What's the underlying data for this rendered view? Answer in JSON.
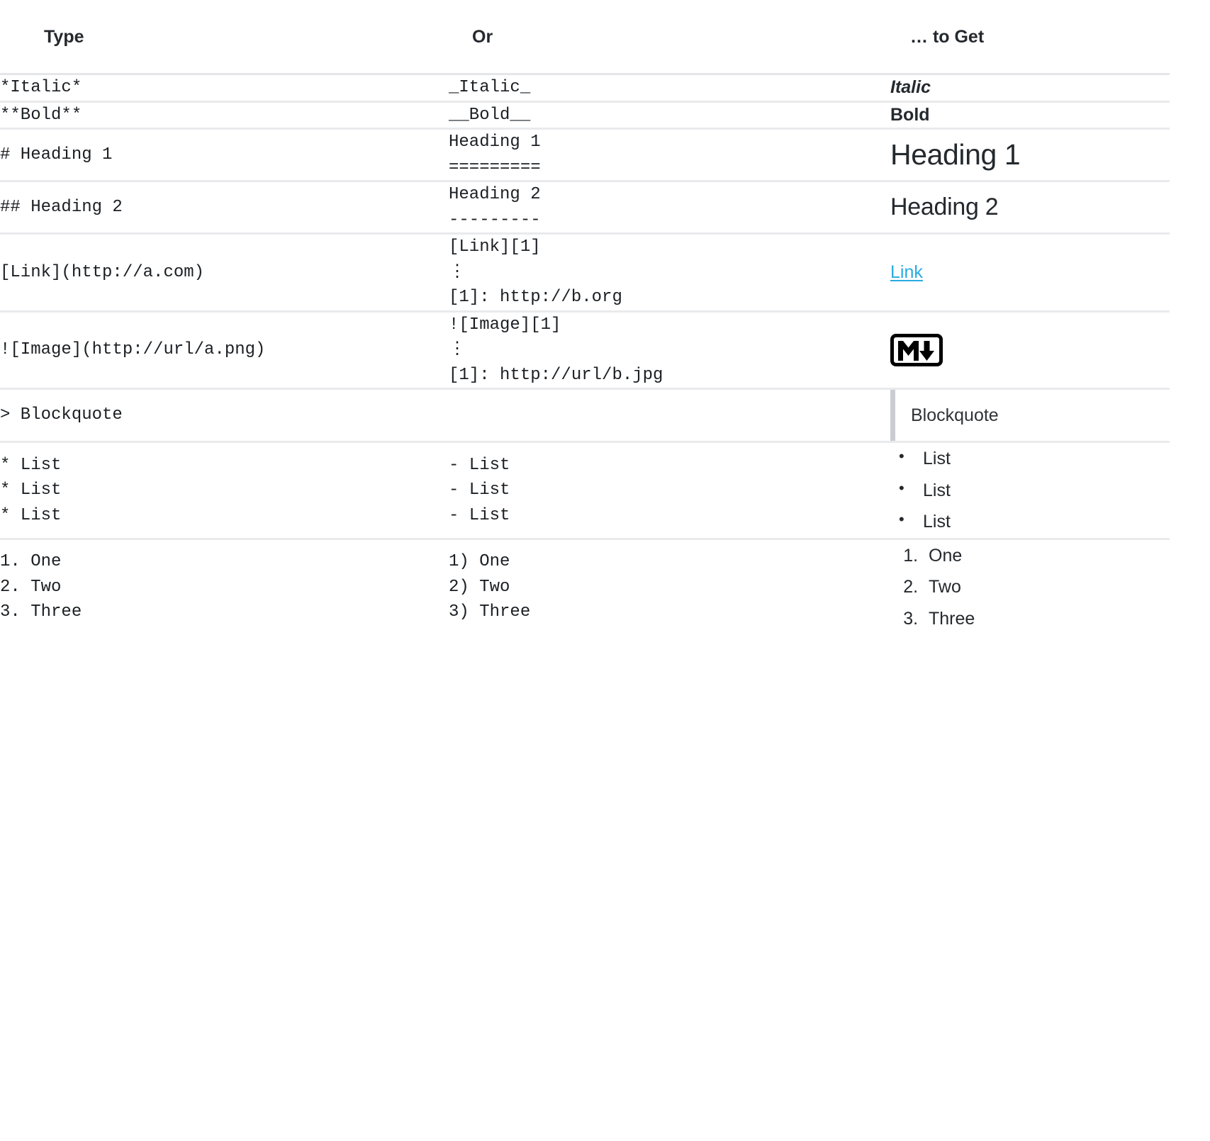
{
  "table": {
    "headers": [
      "Type",
      "Or",
      "… to Get"
    ],
    "rows": [
      {
        "name": "italic",
        "type": "*Italic*",
        "or": "_Italic_",
        "result_text": "Italic"
      },
      {
        "name": "bold",
        "type": "**Bold**",
        "or": "__Bold__",
        "result_text": "Bold"
      },
      {
        "name": "heading-1",
        "type": "# Heading 1",
        "or_line1": "Heading 1",
        "or_line2": "=========",
        "result_text": "Heading 1"
      },
      {
        "name": "heading-2",
        "type": "## Heading 2",
        "or_line1": "Heading 2",
        "or_line2": "---------",
        "result_text": "Heading 2"
      },
      {
        "name": "link",
        "type": "[Link](http://a.com)",
        "or_line1": "[Link][1]",
        "or_line2": "⋮",
        "or_line3": "[1]: http://b.org",
        "result_text": "Link"
      },
      {
        "name": "image",
        "type": "![Image](http://url/a.png)",
        "or_line1": "![Image][1]",
        "or_line2": "⋮",
        "or_line3": "[1]: http://url/b.jpg",
        "result_icon": "markdown-mark-icon"
      },
      {
        "name": "blockquote",
        "type": "> Blockquote",
        "or": "",
        "result_text": "Blockquote"
      },
      {
        "name": "unordered-list",
        "type": "* List\n* List\n* List",
        "or": "- List\n- List\n- List",
        "result_items": [
          "List",
          "List",
          "List"
        ]
      },
      {
        "name": "ordered-list",
        "type": "1. One\n2. Two\n3. Three",
        "or": "1) One\n2) Two\n3) Three",
        "result_items": [
          "One",
          "Two",
          "Three"
        ]
      }
    ]
  },
  "colors": {
    "link": "#29abe2",
    "text": "#24292e",
    "rule": "#e9eaec",
    "quote_bar": "#c9ccd0"
  }
}
